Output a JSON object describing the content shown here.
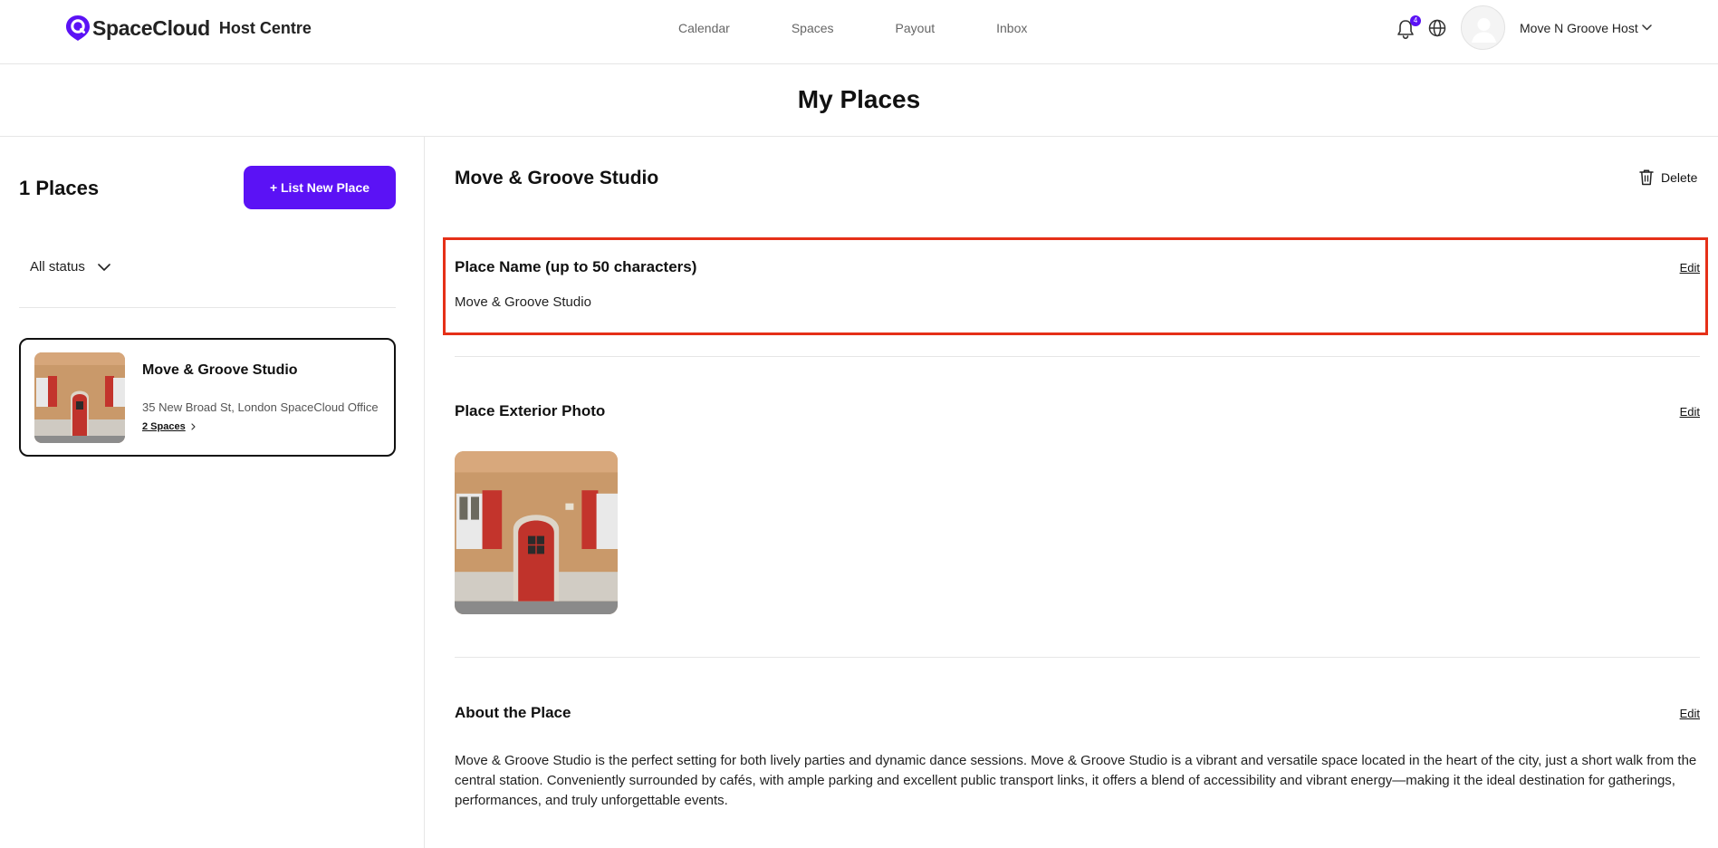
{
  "header": {
    "brand": "SpaceCloud",
    "brand_sub": "Host Centre",
    "nav": [
      "Calendar",
      "Spaces",
      "Payout",
      "Inbox"
    ],
    "notification_count": "4",
    "user_name": "Move N Groove Host",
    "accent_color": "#5b12f5"
  },
  "page": {
    "title": "My Places"
  },
  "sidebar": {
    "count_label": "1 Places",
    "list_button": "+ List New Place",
    "status_filter": "All status",
    "places": [
      {
        "title": "Move & Groove Studio",
        "address": "35 New Broad St, London SpaceCloud Office",
        "spaces_link": "2 Spaces"
      }
    ]
  },
  "detail": {
    "title": "Move & Groove Studio",
    "delete_label": "Delete",
    "sections": {
      "name": {
        "title": "Place Name (up to 50 characters)",
        "edit": "Edit",
        "value": "Move & Groove Studio"
      },
      "photo": {
        "title": "Place Exterior Photo",
        "edit": "Edit"
      },
      "about": {
        "title": "About the Place",
        "edit": "Edit",
        "value": "Move & Groove Studio is the perfect setting for both lively parties and dynamic dance sessions. Move & Groove Studio is a vibrant and versatile space located in the heart of the city, just a short walk from the central station. Conveniently surrounded by cafés, with ample parking and excellent public transport links, it offers a blend of accessibility and vibrant energy—making it the ideal destination for gatherings, performances, and truly unforgettable events."
      }
    },
    "highlight_color": "#e53018"
  }
}
